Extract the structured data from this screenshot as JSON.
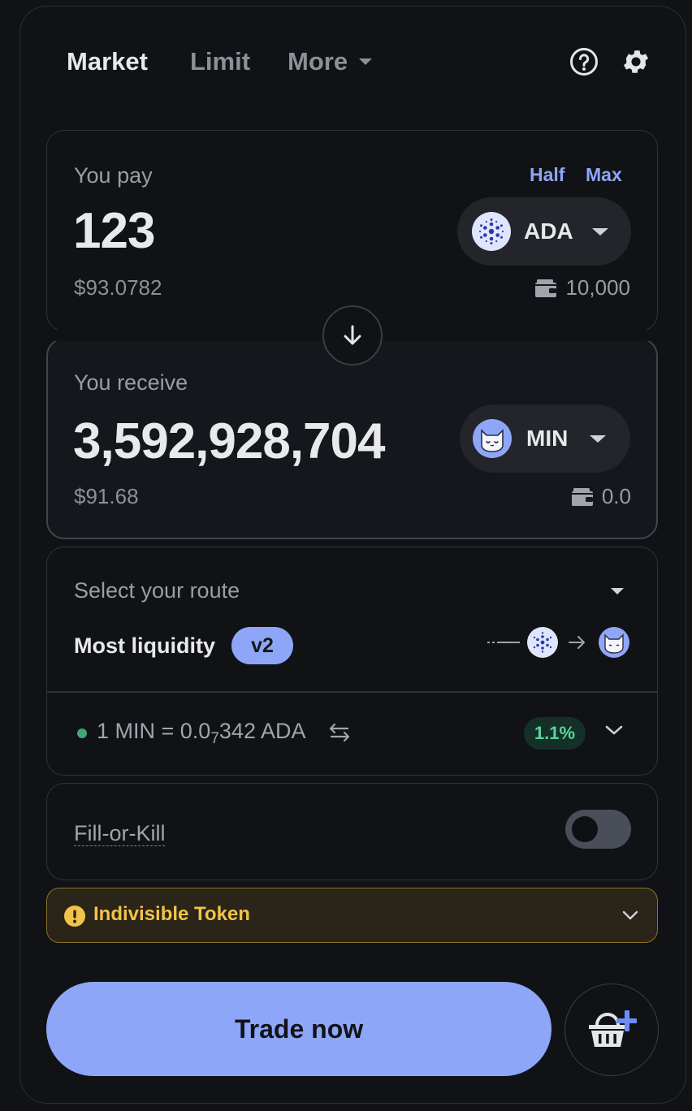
{
  "tabs": {
    "market": "Market",
    "limit": "Limit",
    "more": "More"
  },
  "pay": {
    "label": "You pay",
    "half": "Half",
    "max": "Max",
    "amount": "123",
    "usd": "$93.0782",
    "token": "ADA",
    "balance": "10,000"
  },
  "receive": {
    "label": "You receive",
    "amount": "3,592,928,704",
    "usd": "$91.68",
    "token": "MIN",
    "balance": "0.0"
  },
  "route": {
    "title": "Select your route",
    "name": "Most liquidity",
    "version": "v2",
    "rate_prefix": "1 MIN = 0.0",
    "rate_subscript": "7",
    "rate_suffix": "342 ADA",
    "price_impact": "1.1%"
  },
  "fill_or_kill": {
    "label": "Fill-or-Kill",
    "enabled": false
  },
  "warning": {
    "label": "Indivisible Token"
  },
  "trade_button": "Trade now",
  "colors": {
    "accent": "#8ea6f8",
    "background": "#111216",
    "warning": "#f1c34a",
    "positive": "#5bd49c"
  },
  "icons": [
    "help-circle-icon",
    "gear-icon",
    "arrow-down-icon",
    "wallet-icon",
    "cardano-icon",
    "min-cat-icon",
    "swap-arrows-icon",
    "chevron-down-icon",
    "warning-icon",
    "basket-plus-icon"
  ]
}
